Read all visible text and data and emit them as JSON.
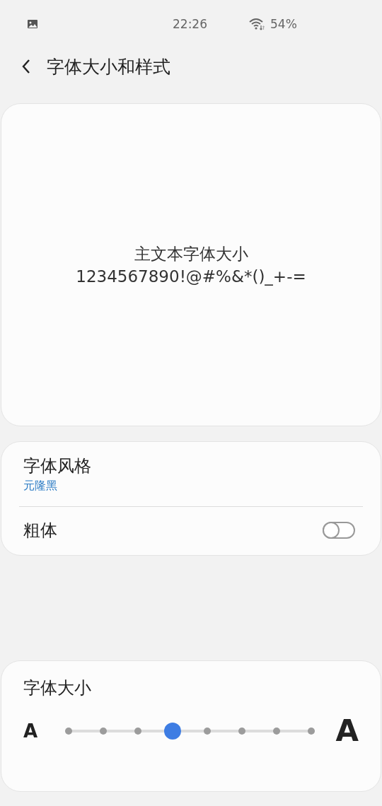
{
  "status_bar": {
    "time": "22:26",
    "battery": "54%"
  },
  "header": {
    "title": "字体大小和样式"
  },
  "preview": {
    "lines": [
      "主文本字体大小",
      "1234567890!@#%&*()_+-="
    ]
  },
  "settings": [
    {
      "kind": "link",
      "label": "字体风格",
      "value": "元隆黑"
    },
    {
      "kind": "toggle",
      "label": "粗体",
      "on": false
    }
  ],
  "font_size": {
    "title": "字体大小",
    "small_label": "A",
    "large_label": "A",
    "level": 0.4286
  }
}
